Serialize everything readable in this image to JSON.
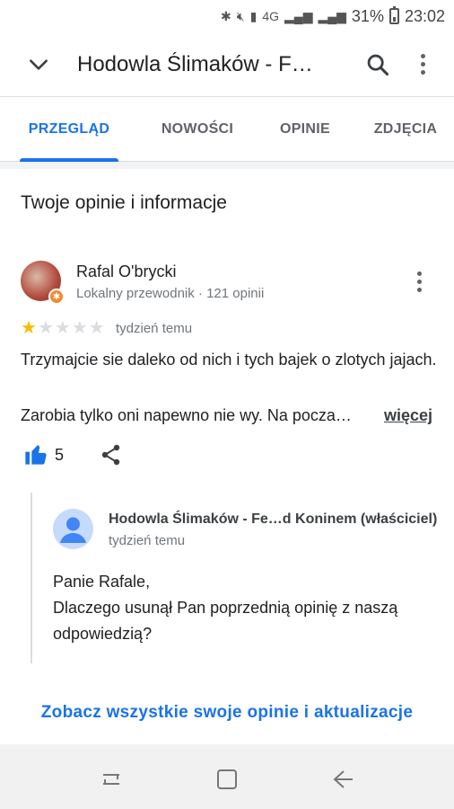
{
  "status_bar": {
    "battery_percent": "31%",
    "time": "23:02",
    "network": "4G"
  },
  "header": {
    "title": "Hodowla Ślimaków - F…",
    "back_icon": "chevron-down-icon",
    "search_icon": "search-icon",
    "menu_icon": "more-vert-icon"
  },
  "tabs": [
    {
      "label": "PRZEGLĄD",
      "active": true
    },
    {
      "label": "NOWOŚCI",
      "active": false
    },
    {
      "label": "OPINIE",
      "active": false
    },
    {
      "label": "ZDJĘCIA",
      "active": false
    }
  ],
  "section": {
    "title": "Twoje opinie i informacje"
  },
  "review": {
    "author": "Rafal O'brycki",
    "meta": "Lokalny przewodnik · 121 opinii",
    "rating": 1,
    "max_rating": 5,
    "date": "tydzień temu",
    "text_line1": "Trzymajcie sie daleko od nich i tych bajek o zlotych jajach.",
    "text_line2": "Zarobia tylko oni napewno nie wy. Na pocza…",
    "more_label": "więcej",
    "likes": "5"
  },
  "owner_reply": {
    "author": "Hodowla Ślimaków - Fe…d Koninem (właściciel)",
    "date": "tydzień temu",
    "line1": "Panie Rafale,",
    "line2": "Dlaczego usunął Pan poprzednią opinię z naszą odpowiedzią?"
  },
  "see_all_link": "Zobacz wszystkie swoje opinie i aktualizacje",
  "colors": {
    "accent": "#1a73e8",
    "star": "#fbbc04",
    "text": "#202124",
    "secondary": "#70757a"
  }
}
